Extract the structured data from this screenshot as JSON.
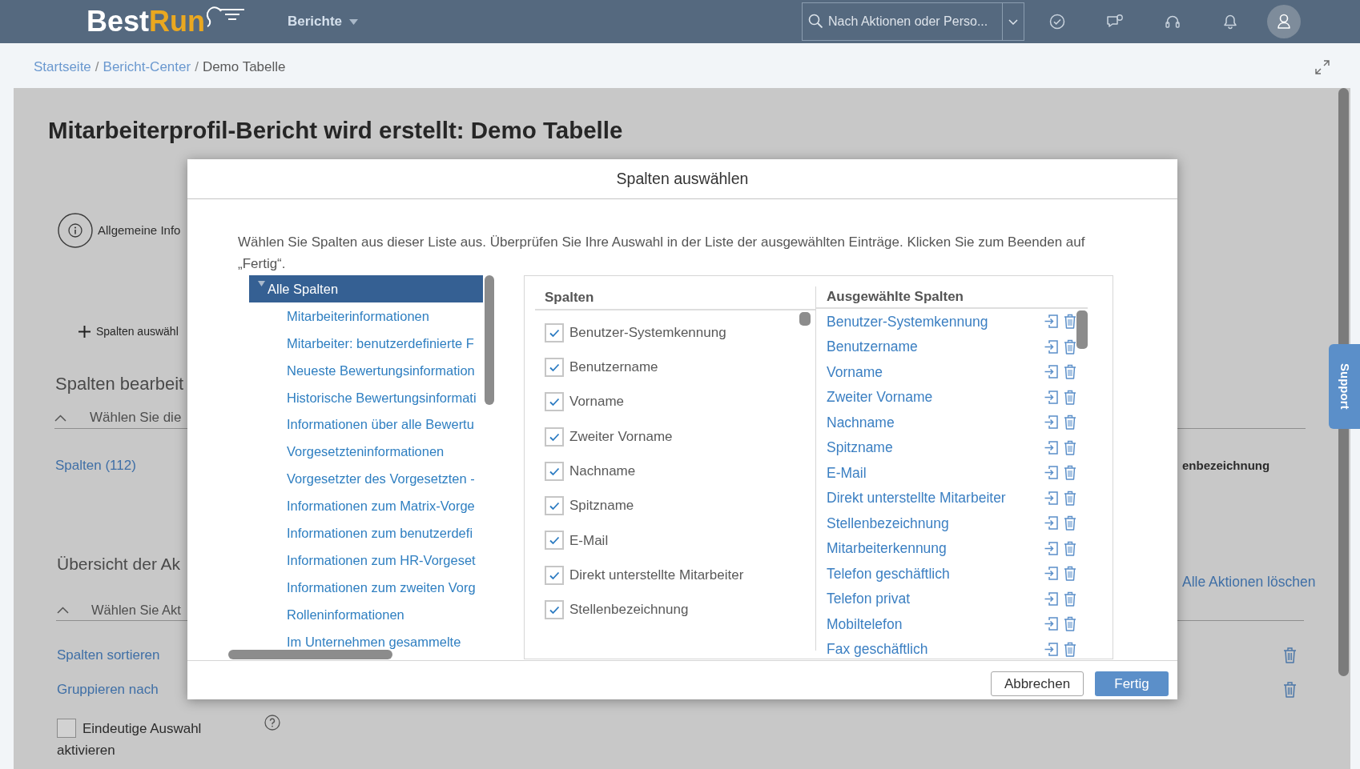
{
  "header": {
    "logo": {
      "text": "Best",
      "accent": "Run"
    },
    "menu": {
      "label": "Berichte"
    },
    "search": {
      "placeholder": "Nach Aktionen oder Perso..."
    }
  },
  "breadcrumb": [
    {
      "kind": "link",
      "label": "Startseite"
    },
    {
      "kind": "separator",
      "label": "/"
    },
    {
      "kind": "link",
      "label": "Bericht-Center"
    },
    {
      "kind": "separator",
      "label": "/"
    },
    {
      "kind": "current",
      "label": "Demo Tabelle"
    }
  ],
  "page": {
    "title": "Mitarbeiterprofil-Bericht wird erstellt: Demo Tabelle",
    "step": {
      "label": "Allgemeine Info"
    },
    "add_columns": {
      "label": "Spalten auswähl"
    },
    "edit_section": {
      "heading": "Spalten bearbeit",
      "subtitle": "Wählen Sie die",
      "expanded": true,
      "columns_link": "Spalten (112)",
      "column_name": "enbezeichnung"
    },
    "actions_section": {
      "heading": "Übersicht der Ak",
      "subtitle": "Wählen Sie Akt",
      "expanded": true,
      "clear_link": "Alle Aktionen löschen",
      "actions": [
        {
          "label": "Spalten sortieren"
        },
        {
          "label": "Gruppieren nach"
        }
      ]
    },
    "unique_selection": {
      "label": "Eindeutige Auswahl aktivieren",
      "checked": false
    }
  },
  "support_tab": {
    "label": "Support"
  },
  "dialog": {
    "title": "Spalten auswählen",
    "instructions": "Wählen Sie Spalten aus dieser Liste aus. Überprüfen Sie Ihre Auswahl in der Liste der ausgewählten Einträge. Klicken Sie zum Beenden auf „Fertig“.",
    "tree": [
      {
        "label": "Alle Spalten",
        "selected": true,
        "expanded": true,
        "children": [
          {
            "label": "Mitarbeiterinformationen",
            "selected": false
          },
          {
            "label": "Mitarbeiter: benutzerdefinierte F",
            "selected": false
          },
          {
            "label": "Neueste Bewertungsinformation",
            "selected": false
          },
          {
            "label": "Historische Bewertungsinformati",
            "selected": false
          },
          {
            "label": "Informationen über alle Bewertu",
            "selected": false
          },
          {
            "label": "Vorgesetzteninformationen",
            "selected": false
          },
          {
            "label": "Vorgesetzter des Vorgesetzten -",
            "selected": false
          },
          {
            "label": "Informationen zum Matrix-Vorge",
            "selected": false
          },
          {
            "label": "Informationen zum benutzerdefi",
            "selected": false
          },
          {
            "label": "Informationen zum HR-Vorgeset",
            "selected": false
          },
          {
            "label": "Informationen zum zweiten Vorg",
            "selected": false
          },
          {
            "label": "Rolleninformationen",
            "selected": false
          },
          {
            "label": "Im Unternehmen gesammelte",
            "selected": false
          }
        ]
      }
    ],
    "columns": {
      "heading": "Spalten",
      "items": [
        {
          "label": "Benutzer-Systemkennung",
          "checked": true
        },
        {
          "label": "Benutzername",
          "checked": true
        },
        {
          "label": "Vorname",
          "checked": true
        },
        {
          "label": "Zweiter Vorname",
          "checked": true
        },
        {
          "label": "Nachname",
          "checked": true
        },
        {
          "label": "Spitzname",
          "checked": true
        },
        {
          "label": "E-Mail",
          "checked": true
        },
        {
          "label": "Direkt unterstellte Mitarbeiter",
          "checked": true
        },
        {
          "label": "Stellenbezeichnung",
          "checked": true
        }
      ]
    },
    "selected_columns": {
      "heading": "Ausgewählte Spalten",
      "items": [
        {
          "label": "Benutzer-Systemkennung"
        },
        {
          "label": "Benutzername"
        },
        {
          "label": "Vorname"
        },
        {
          "label": "Zweiter Vorname"
        },
        {
          "label": "Nachname"
        },
        {
          "label": "Spitzname"
        },
        {
          "label": "E-Mail"
        },
        {
          "label": "Direkt unterstellte Mitarbeiter"
        },
        {
          "label": "Stellenbezeichnung"
        },
        {
          "label": "Mitarbeiterkennung"
        },
        {
          "label": "Telefon geschäftlich"
        },
        {
          "label": "Telefon privat"
        },
        {
          "label": "Mobiltelefon"
        },
        {
          "label": "Fax geschäftlich"
        }
      ]
    },
    "buttons": [
      {
        "label": "Abbrechen",
        "kind": "secondary"
      },
      {
        "label": "Fertig",
        "kind": "primary"
      }
    ]
  }
}
